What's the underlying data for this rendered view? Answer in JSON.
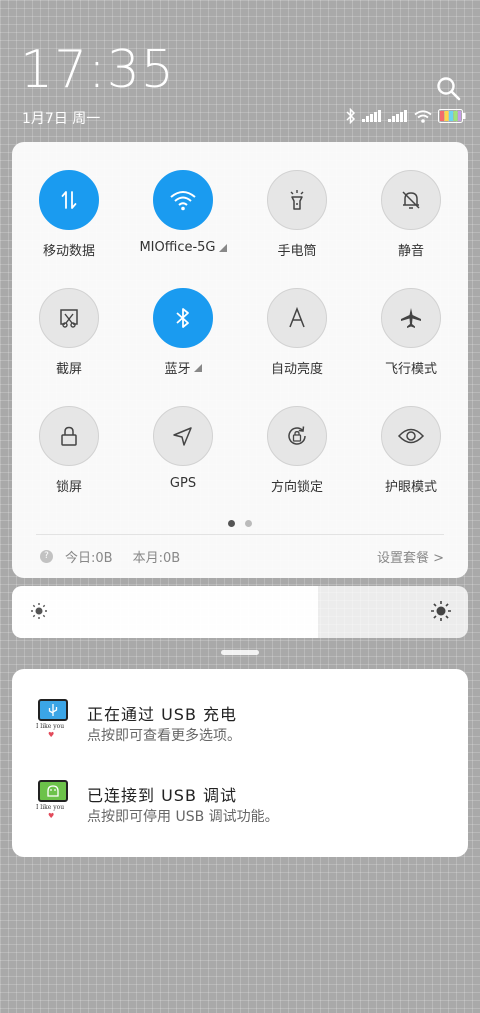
{
  "status": {
    "time": "17:35",
    "date": "1月7日 周一",
    "icons": [
      "bluetooth-icon",
      "signal-icon",
      "signal-icon",
      "wifi-icon",
      "battery-icon"
    ]
  },
  "quick_settings": {
    "toggles": [
      {
        "label": "移动数据",
        "icon": "mobile-data-icon",
        "on": true
      },
      {
        "label": "MIOffice-5G",
        "icon": "wifi-icon",
        "on": true,
        "has_more": true
      },
      {
        "label": "手电筒",
        "icon": "flashlight-icon",
        "on": false
      },
      {
        "label": "静音",
        "icon": "mute-bell-icon",
        "on": false
      },
      {
        "label": "截屏",
        "icon": "screenshot-icon",
        "on": false
      },
      {
        "label": "蓝牙",
        "icon": "bluetooth-icon",
        "on": true,
        "has_more": true
      },
      {
        "label": "自动亮度",
        "icon": "auto-brightness-icon",
        "on": false
      },
      {
        "label": "飞行模式",
        "icon": "airplane-icon",
        "on": false
      },
      {
        "label": "锁屏",
        "icon": "lock-icon",
        "on": false
      },
      {
        "label": "GPS",
        "icon": "gps-icon",
        "on": false
      },
      {
        "label": "方向锁定",
        "icon": "rotation-lock-icon",
        "on": false
      },
      {
        "label": "护眼模式",
        "icon": "eye-icon",
        "on": false
      }
    ],
    "page_count": 2,
    "active_page": 1,
    "data_usage": {
      "help": "?",
      "today": "今日:0B",
      "month": "本月:0B",
      "settings_link": "设置套餐 >"
    },
    "accent_color": "#1a9bf0"
  },
  "brightness": {
    "level_percent": 67
  },
  "notifications": [
    {
      "title": "正在通过 USB 充电",
      "text": "点按即可查看更多选项。",
      "icon": "usb-icon",
      "icon_text": "I like you"
    },
    {
      "title": "已连接到 USB 调试",
      "text": "点按即可停用 USB 调试功能。",
      "icon": "android-debug-icon",
      "icon_text": "I like you"
    }
  ]
}
